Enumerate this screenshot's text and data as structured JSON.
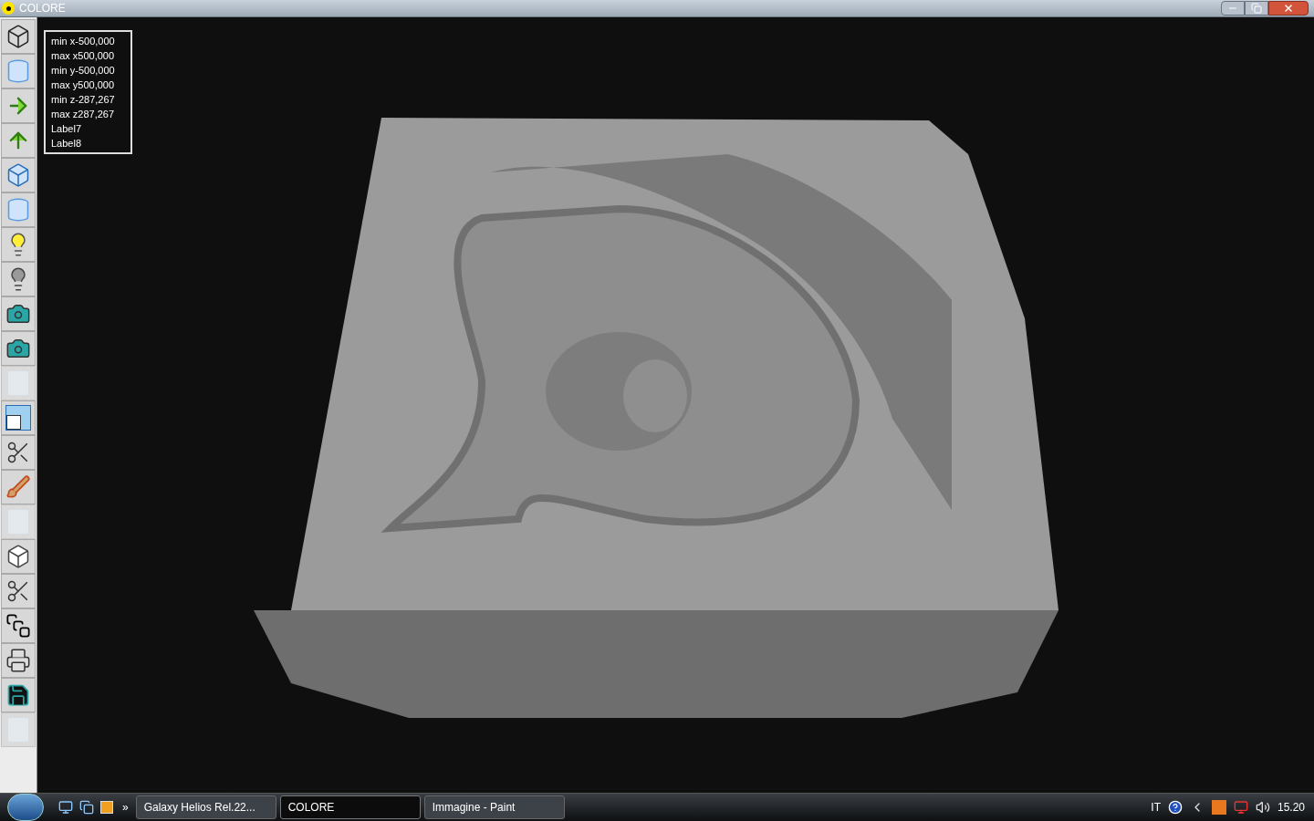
{
  "window": {
    "title": "COLORE"
  },
  "toolbar": [
    {
      "kind": "wireframe",
      "disabled": false
    },
    {
      "kind": "cylinder",
      "disabled": false
    },
    {
      "kind": "arrow-right",
      "disabled": false
    },
    {
      "kind": "arrow-up",
      "disabled": false
    },
    {
      "kind": "box-up",
      "disabled": false
    },
    {
      "kind": "cylinder",
      "disabled": false
    },
    {
      "kind": "bulb-on",
      "disabled": false
    },
    {
      "kind": "bulb-off",
      "disabled": false
    },
    {
      "kind": "camera",
      "disabled": false
    },
    {
      "kind": "camera",
      "disabled": false
    },
    {
      "kind": "blank",
      "disabled": true
    },
    {
      "kind": "window",
      "disabled": false
    },
    {
      "kind": "scissors",
      "disabled": false
    },
    {
      "kind": "brush",
      "disabled": false
    },
    {
      "kind": "blank",
      "disabled": true
    },
    {
      "kind": "cube",
      "disabled": false
    },
    {
      "kind": "scissors",
      "disabled": false
    },
    {
      "kind": "squares",
      "disabled": false
    },
    {
      "kind": "printer",
      "disabled": false
    },
    {
      "kind": "floppy",
      "disabled": false
    },
    {
      "kind": "blank",
      "disabled": true
    }
  ],
  "info_labels": [
    "min x-500,000",
    "max x500,000",
    "min y-500,000",
    "max y500,000",
    "min z-287,267",
    "max z287,267",
    "Label7",
    "Label8"
  ],
  "taskbar": {
    "tasks": [
      {
        "label": "Galaxy Helios  Rel.22...",
        "selected": false
      },
      {
        "label": "COLORE",
        "selected": true
      },
      {
        "label": "Immagine - Paint",
        "selected": false
      }
    ],
    "overflow": "»",
    "language": "IT",
    "clock": "15.20"
  }
}
